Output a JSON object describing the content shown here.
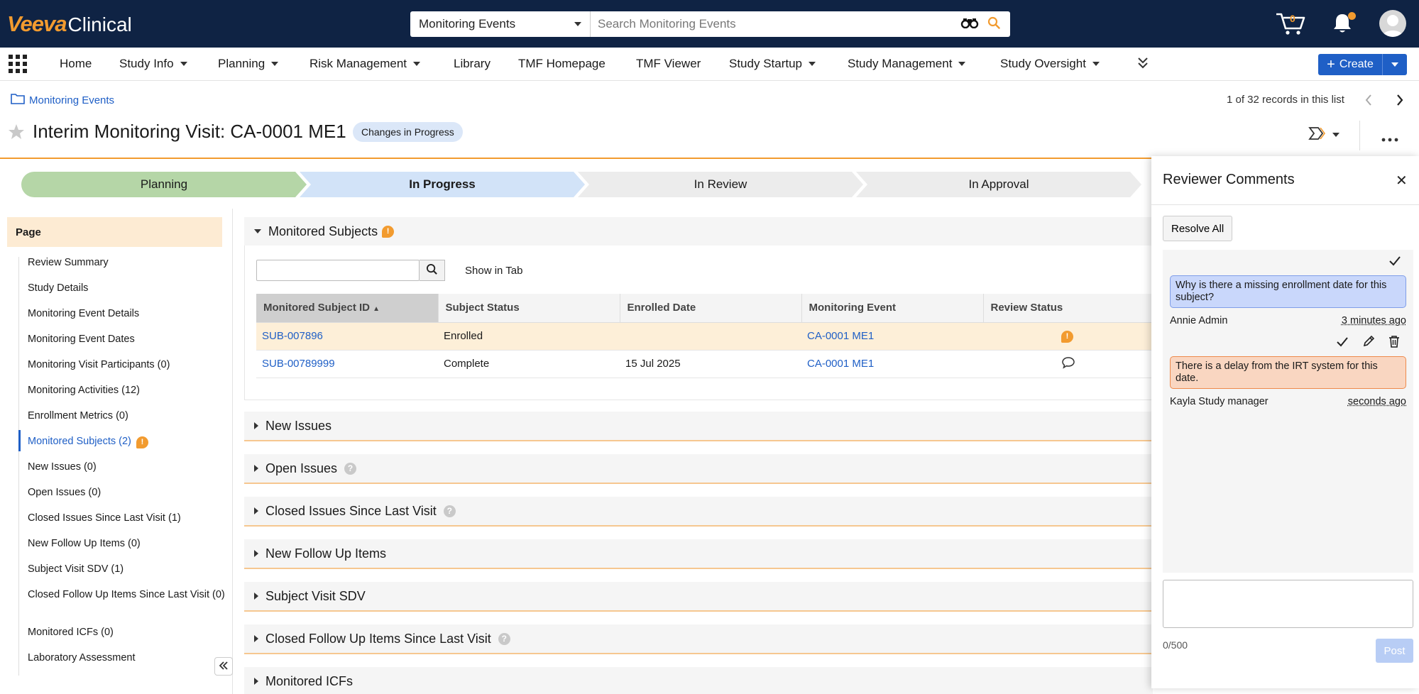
{
  "app": {
    "logo_primary": "Veeva",
    "logo_secondary": "Clinical"
  },
  "search": {
    "scope": "Monitoring Events",
    "placeholder": "Search Monitoring Events"
  },
  "header": {
    "cart_count": "0"
  },
  "nav": {
    "items": [
      {
        "label": "Home",
        "has_menu": false
      },
      {
        "label": "Study Info",
        "has_menu": true
      },
      {
        "label": "Planning",
        "has_menu": true
      },
      {
        "label": "Risk Management",
        "has_menu": true
      },
      {
        "label": "Library",
        "has_menu": false
      },
      {
        "label": "TMF Homepage",
        "has_menu": false
      },
      {
        "label": "TMF Viewer",
        "has_menu": false
      },
      {
        "label": "Study Startup",
        "has_menu": true
      },
      {
        "label": "Study Management",
        "has_menu": true
      },
      {
        "label": "Study Oversight",
        "has_menu": true
      }
    ],
    "create_label": "Create"
  },
  "breadcrumb": {
    "label": "Monitoring Events"
  },
  "records": {
    "label": "1 of 32 records in this list"
  },
  "record": {
    "title": "Interim Monitoring Visit: CA-0001 ME1",
    "state": "Changes in Progress"
  },
  "lifecycle": {
    "stages": [
      {
        "label": "Planning",
        "status": "done"
      },
      {
        "label": "In Progress",
        "status": "current"
      },
      {
        "label": "In Review",
        "status": "pending"
      },
      {
        "label": "In Approval",
        "status": "pending"
      }
    ]
  },
  "sidebar": {
    "heading": "Page",
    "items": [
      {
        "label": "Review Summary"
      },
      {
        "label": "Study Details"
      },
      {
        "label": "Monitoring Event Details"
      },
      {
        "label": "Monitoring Event Dates"
      },
      {
        "label": "Monitoring Visit Participants (0)"
      },
      {
        "label": "Monitoring Activities (12)"
      },
      {
        "label": "Enrollment Metrics (0)"
      },
      {
        "label": "Monitored Subjects (2)",
        "active": true,
        "flag": true
      },
      {
        "label": "New Issues (0)"
      },
      {
        "label": "Open Issues (0)"
      },
      {
        "label": "Closed Issues Since Last Visit (1)"
      },
      {
        "label": "New Follow Up Items (0)"
      },
      {
        "label": "Subject Visit SDV (1)"
      },
      {
        "label": "Closed Follow Up Items Since Last Visit (0)"
      },
      {
        "label": "Monitored ICFs (0)"
      },
      {
        "label": "Laboratory Assessment"
      }
    ]
  },
  "monitored_subjects": {
    "title": "Monitored Subjects",
    "show_in_tab": "Show in Tab",
    "columns": [
      "Monitored Subject ID",
      "Subject Status",
      "Enrolled Date",
      "Monitoring Event",
      "Review Status"
    ],
    "rows": [
      {
        "id": "SUB-007896",
        "status": "Enrolled",
        "enrolled": "",
        "event": "CA-0001 ME1",
        "review": "flag"
      },
      {
        "id": "SUB-00789999",
        "status": "Complete",
        "enrolled": "15 Jul 2025",
        "event": "CA-0001 ME1",
        "review": "comment"
      }
    ]
  },
  "sections": [
    {
      "label": "New Issues",
      "help": false
    },
    {
      "label": "Open Issues",
      "help": true
    },
    {
      "label": "Closed Issues Since Last Visit",
      "help": true
    },
    {
      "label": "New Follow Up Items",
      "help": false
    },
    {
      "label": "Subject Visit SDV",
      "help": false
    },
    {
      "label": "Closed Follow Up Items Since Last Visit",
      "help": true
    },
    {
      "label": "Monitored ICFs",
      "help": false
    }
  ],
  "reviewer_comments": {
    "title": "Reviewer Comments",
    "resolve_all": "Resolve All",
    "comments": [
      {
        "text": "Why is there a missing enrollment date for this subject?",
        "author": "Annie Admin",
        "time": "3 minutes ago"
      },
      {
        "text": "There is a delay from the IRT system for this date.",
        "author": "Kayla Study manager",
        "time": "seconds ago"
      }
    ],
    "counter": "0/500",
    "post_label": "Post"
  },
  "colors": {
    "brand_navy": "#0f2344",
    "brand_orange": "#f29b2f",
    "link_blue": "#1f5fc6",
    "stage_done": "#b5d6a7",
    "stage_current": "#d2e3f8",
    "stage_pending": "#ececec"
  }
}
